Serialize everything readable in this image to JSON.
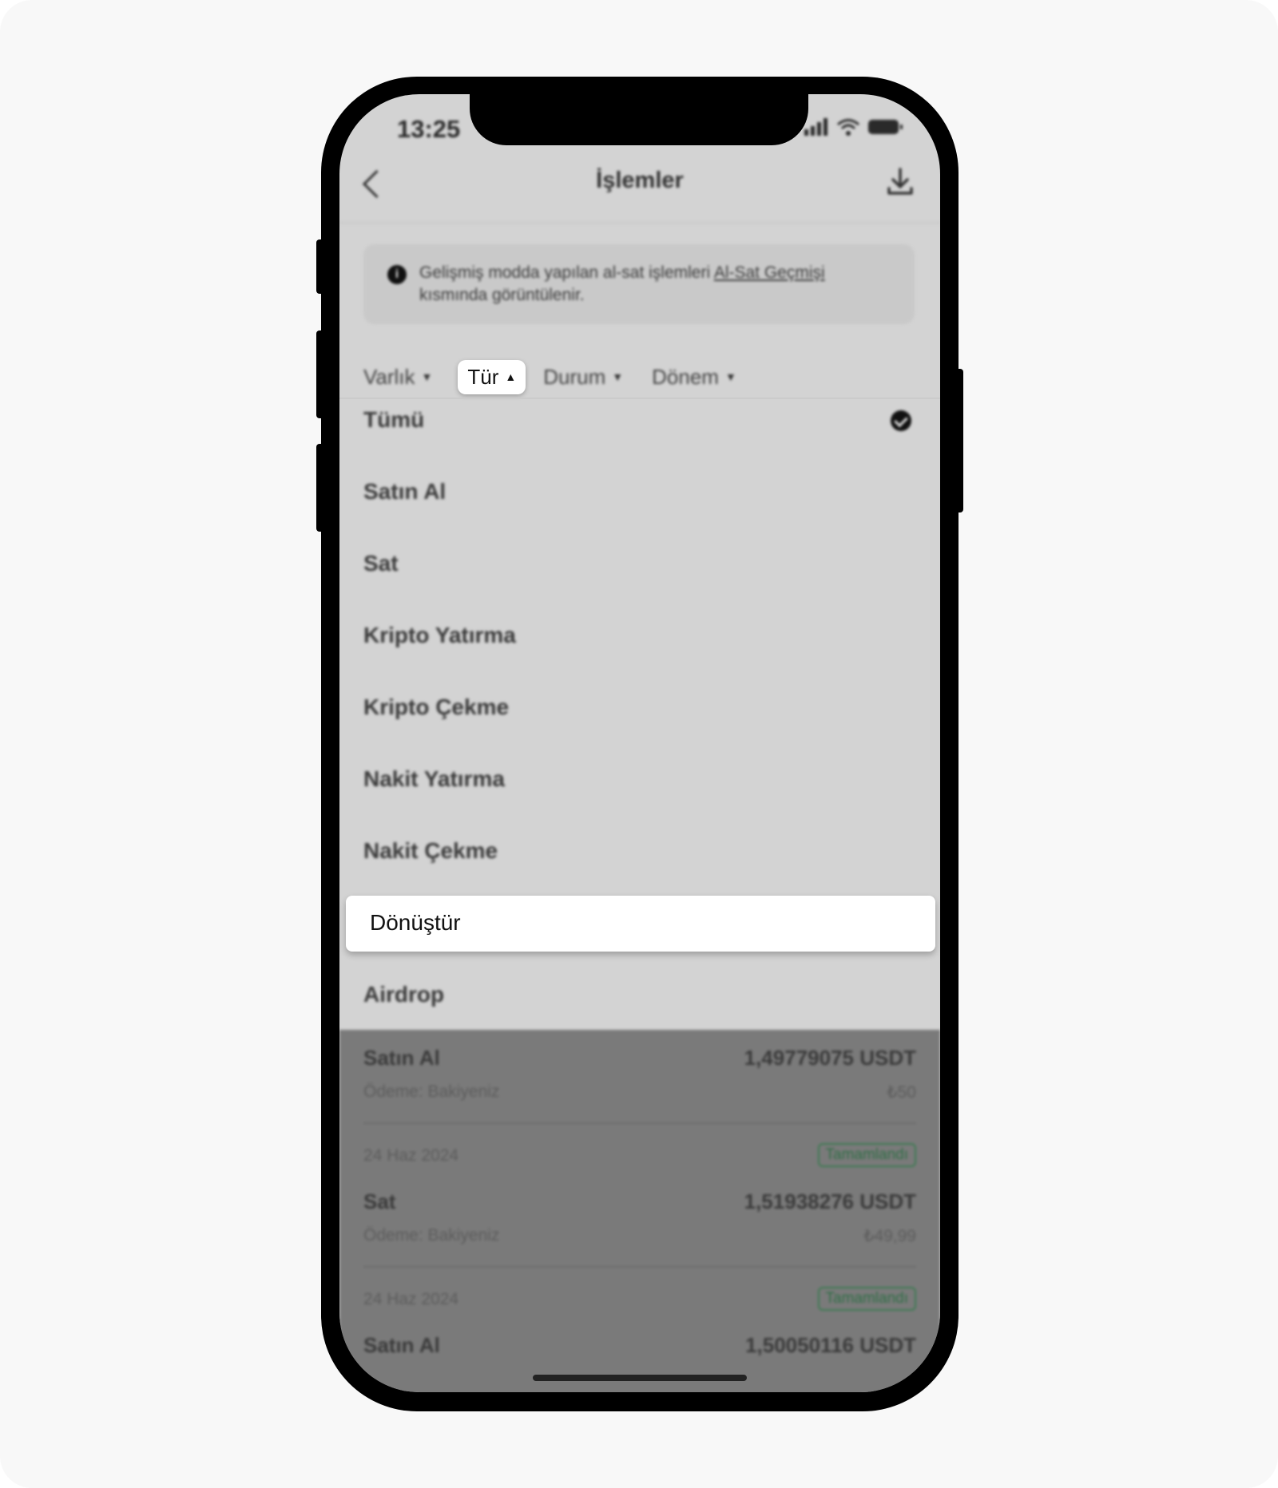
{
  "status_bar": {
    "time": "13:25"
  },
  "header": {
    "title": "İşlemler"
  },
  "info": {
    "icon": "info-icon",
    "text_before": "Gelişmiş modda yapılan al-sat işlemleri ",
    "link": "Al-Sat Geçmişi",
    "text_after": "kısmında görüntülenir."
  },
  "filters": [
    {
      "label": "Varlık"
    },
    {
      "label": "Tür"
    },
    {
      "label": "Durum"
    },
    {
      "label": "Dönem"
    }
  ],
  "type_options": [
    "Tümü",
    "Satın Al",
    "Sat",
    "Kripto Yatırma",
    "Kripto Çekme",
    "Nakit Yatırma",
    "Nakit Çekme",
    "Dönüştür",
    "Airdrop"
  ],
  "selected_option": "Tümü",
  "transactions": [
    {
      "type": "Satın Al",
      "amount": "1,49779075 USDT",
      "payment": "Ödeme: Bakiyeniz",
      "fiat": "₺50"
    },
    {
      "date": "24 Haz 2024",
      "status": "Tamamlandı",
      "type": "Sat",
      "amount": "1,51938276 USDT",
      "payment": "Ödeme: Bakiyeniz",
      "fiat": "₺49,99"
    },
    {
      "date": "24 Haz 2024",
      "status": "Tamamlandı",
      "type": "Satın Al",
      "amount": "1,50050116 USDT"
    }
  ],
  "colors": {
    "overlay": "#d3d3d3",
    "highlight": "#ffffff",
    "status_green": "#2e6e45"
  }
}
